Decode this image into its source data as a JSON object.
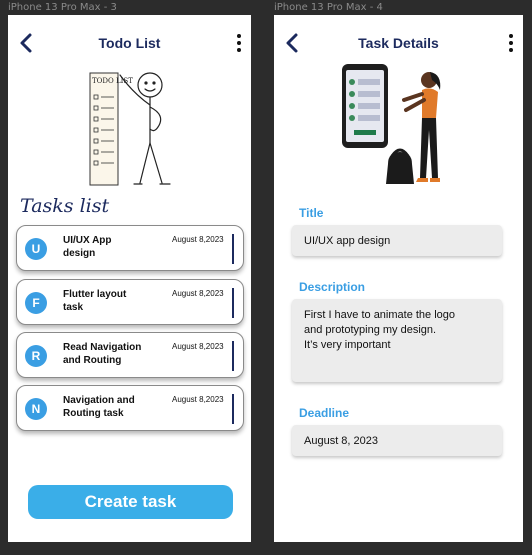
{
  "frames": {
    "left_label": "iPhone 13 Pro Max - 3",
    "right_label": "iPhone 13 Pro Max - 4"
  },
  "todo_screen": {
    "title": "Todo List",
    "illustration_text": "TODO LIST",
    "tasks_heading": "Tasks list",
    "tasks": [
      {
        "initial": "U",
        "title": "UI/UX App design",
        "date": "August 8,2023"
      },
      {
        "initial": "F",
        "title": "Flutter layout task",
        "date": "August 8,2023"
      },
      {
        "initial": "R",
        "title": "Read Navigation and Routing",
        "date": "August 8,2023"
      },
      {
        "initial": "N",
        "title": "Navigation and Routing task",
        "date": "August 8,2023"
      }
    ],
    "create_button_label": "Create task"
  },
  "details_screen": {
    "title": "Task Details",
    "title_label": "Title",
    "title_value": "UI/UX app design",
    "description_label": "Description",
    "description_lines": [
      "First I have to animate the logo",
      "and prototyping my design.",
      "It’s very important"
    ],
    "deadline_label": "Deadline",
    "deadline_value": "August 8, 2023"
  },
  "colors": {
    "accent": "#3a9ee3",
    "navy": "#1c2a5e",
    "button": "#3aaee8",
    "field_bg": "#ececec"
  },
  "icons": [
    "back-arrow-icon",
    "more-vertical-icon"
  ]
}
